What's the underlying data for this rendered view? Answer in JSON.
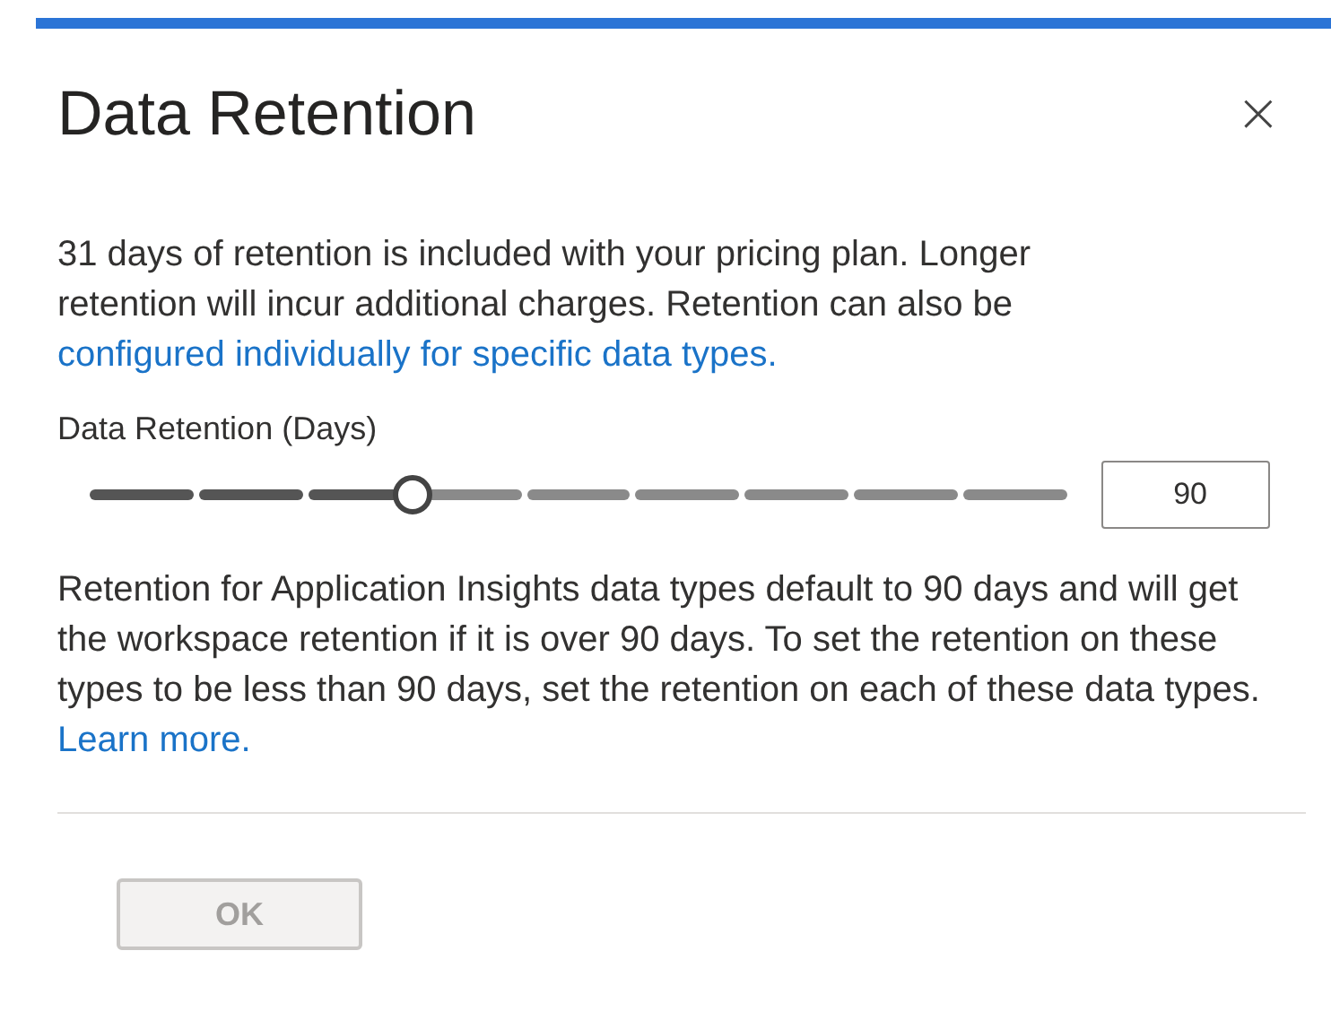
{
  "dialog": {
    "title": "Data Retention",
    "close": "×"
  },
  "intro": {
    "text": "31 days of retention is included with your pricing plan. Longer retention will incur additional charges. Retention can also be ",
    "link": "configured individually for specific data types."
  },
  "slider": {
    "label": "Data Retention (Days)",
    "level": 0.33,
    "value": "90"
  },
  "note": {
    "text": "Retention for Application Insights data types default to 90 days and will get the workspace retention if it is over 90 days. To set the retention on these types to be less than 90 days, set the retention on each of these data types. ",
    "link": "Learn more."
  },
  "buttons": [
    {
      "label": "OK",
      "disabled": true
    }
  ]
}
